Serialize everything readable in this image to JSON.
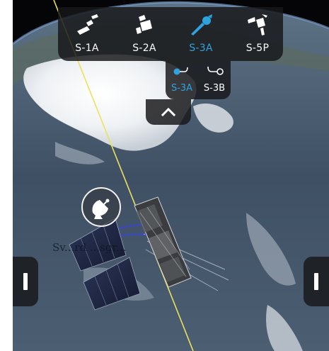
{
  "satellite_selector": {
    "items": [
      {
        "label": "S-1A",
        "icon": "sentinel-1-satellite-icon",
        "active": false
      },
      {
        "label": "S-2A",
        "icon": "sentinel-2-satellite-icon",
        "active": false
      },
      {
        "label": "S-3A",
        "icon": "sentinel-3-satellite-icon",
        "active": true
      },
      {
        "label": "S-5P",
        "icon": "sentinel-5p-satellite-icon",
        "active": false
      }
    ]
  },
  "unit_selector": {
    "items": [
      {
        "label": "S-3A",
        "icon": "orbit-a-icon",
        "active": true
      },
      {
        "label": "S-3B",
        "icon": "orbit-b-icon",
        "active": false
      }
    ]
  },
  "collapse": {
    "icon": "chevron-up-icon"
  },
  "side_buttons": {
    "left_icon": "left-panel-grip-icon",
    "right_icon": "right-panel-grip-icon"
  },
  "ground_station": {
    "icon": "satellite-dish-icon",
    "label": "Sv...rd   ...sgr..."
  },
  "colors": {
    "accent": "#2fa2e0",
    "bar": "#18181a",
    "orbit_track": "#e8e35a",
    "text": "#ffffff"
  }
}
